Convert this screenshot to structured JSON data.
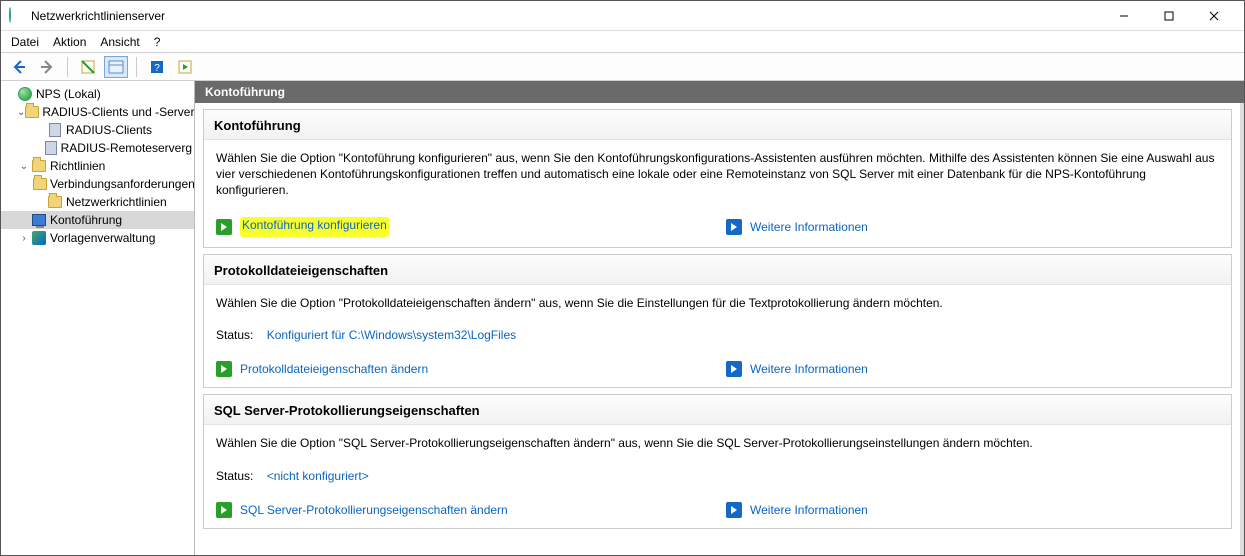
{
  "window": {
    "title": "Netzwerkrichtlinienserver"
  },
  "menu": {
    "file": "Datei",
    "action": "Aktion",
    "view": "Ansicht",
    "help": "?"
  },
  "tree": {
    "root": "NPS (Lokal)",
    "radius_group": "RADIUS-Clients und -Server",
    "radius_clients": "RADIUS-Clients",
    "radius_remote": "RADIUS-Remoteserverg",
    "policies": "Richtlinien",
    "connreq": "Verbindungsanforderungen",
    "netpol": "Netzwerkrichtlinien",
    "accounting": "Kontoführung",
    "templates": "Vorlagenverwaltung"
  },
  "content": {
    "header": "Kontoführung",
    "s1": {
      "title": "Kontoführung",
      "desc": "Wählen Sie die Option \"Kontoführung konfigurieren\" aus, wenn Sie den Kontoführungskonfigurations-Assistenten ausführen möchten. Mithilfe des Assistenten können Sie eine Auswahl aus vier verschiedenen Kontoführungskonfigurationen treffen und automatisch eine lokale oder eine Remoteinstanz von SQL Server mit einer Datenbank für die NPS-Kontoführung konfigurieren.",
      "link_configure": "Kontoführung konfigurieren",
      "link_more": "Weitere Informationen"
    },
    "s2": {
      "title": "Protokolldateieigenschaften",
      "desc": "Wählen Sie die Option \"Protokolldateieigenschaften ändern\" aus, wenn Sie die Einstellungen für die Textprotokollierung ändern möchten.",
      "status_label": "Status:",
      "status_value": "Konfiguriert für C:\\Windows\\system32\\LogFiles",
      "link_change": "Protokolldateieigenschaften ändern",
      "link_more": "Weitere Informationen"
    },
    "s3": {
      "title": "SQL Server-Protokollierungseigenschaften",
      "desc": "Wählen Sie die Option \"SQL Server-Protokollierungseigenschaften ändern\" aus, wenn Sie die SQL Server-Protokollierungseinstellungen ändern möchten.",
      "status_label": "Status:",
      "status_value": "<nicht konfiguriert>",
      "link_change": "SQL Server-Protokollierungseigenschaften ändern",
      "link_more": "Weitere Informationen"
    }
  }
}
